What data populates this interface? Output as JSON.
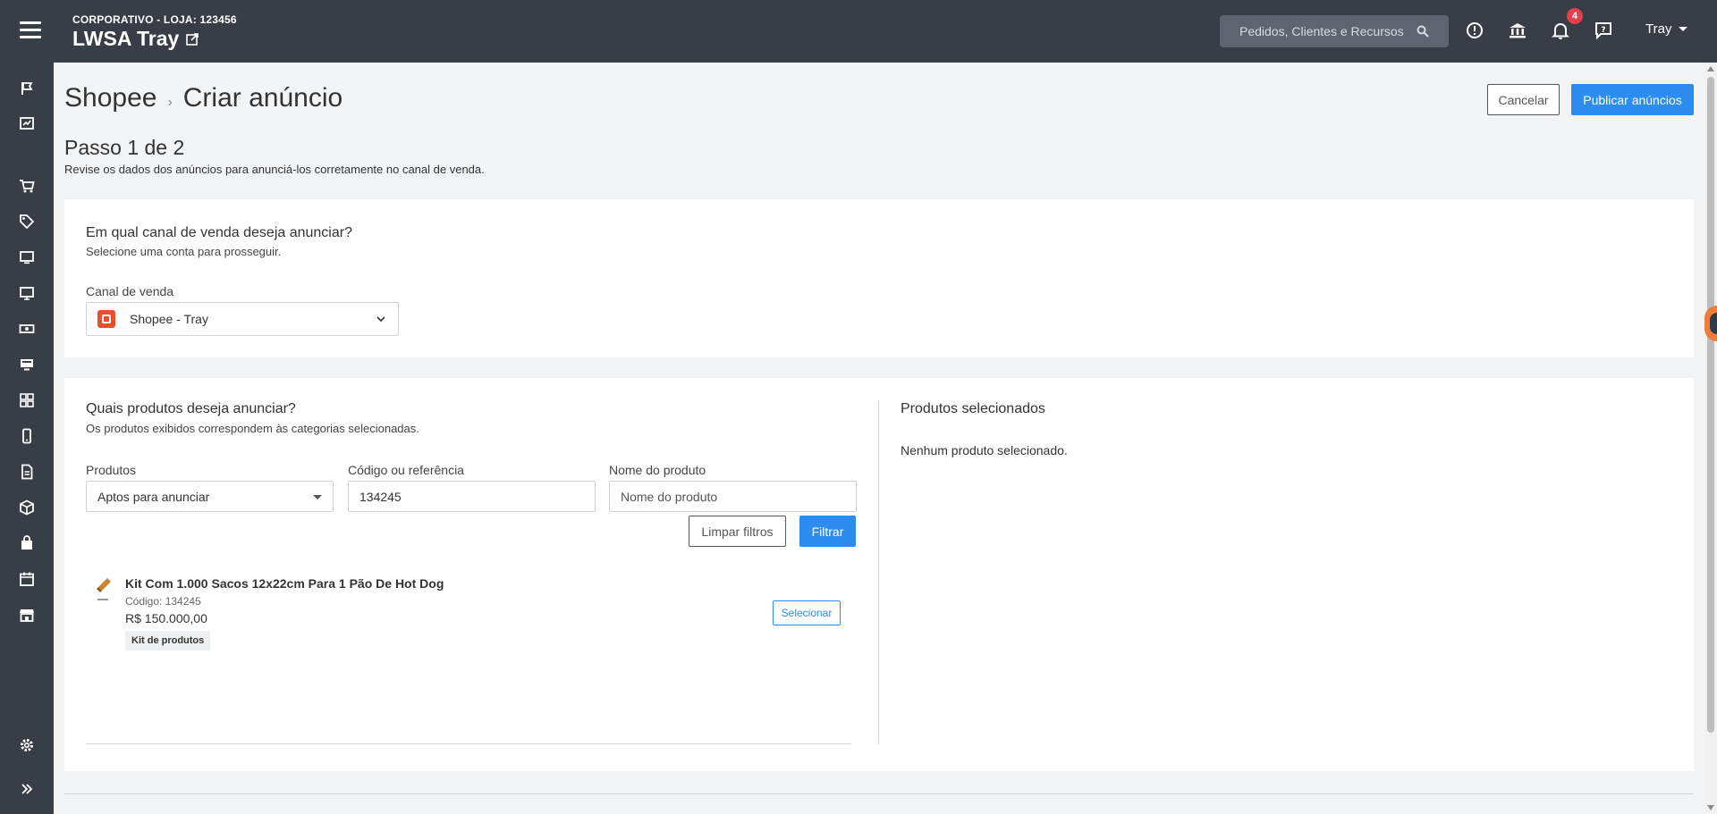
{
  "header": {
    "store_line": "CORPORATIVO - LOJA: 123456",
    "store_name": "LWSA Tray",
    "search_placeholder": "Pedidos, Clientes e Recursos",
    "notifications_count": "4",
    "user_name": "Tray"
  },
  "sidebar": {
    "icons": [
      "flag-icon",
      "dashboard-icon",
      "cart-icon",
      "tag-icon",
      "monitor-icon",
      "screen-icon",
      "money-icon",
      "desktop-icon",
      "apps-icon",
      "mobile-icon",
      "document-icon",
      "box-icon",
      "bag-icon",
      "calendar-icon",
      "store-icon",
      "settings-icon",
      "expand-icon"
    ]
  },
  "page": {
    "breadcrumb_root": "Shopee",
    "breadcrumb_separator": "›",
    "breadcrumb_current": "Criar anúncio",
    "cancel_label": "Cancelar",
    "publish_label": "Publicar anúncios",
    "step_title": "Passo 1 de 2",
    "step_subtitle": "Revise os dados dos anúncios para anunciá-los corretamente no canal de venda."
  },
  "channel_card": {
    "title": "Em qual canal de venda deseja anunciar?",
    "subtitle": "Selecione uma conta para prosseguir.",
    "field_label": "Canal de venda",
    "selected_channel": "Shopee - Tray"
  },
  "products_card": {
    "title": "Quais produtos deseja anunciar?",
    "subtitle": "Os produtos exibidos correspondem às categorias selecionadas.",
    "filters": {
      "products_label": "Produtos",
      "products_value": "Aptos para anunciar",
      "code_label": "Código ou referência",
      "code_value": "134245",
      "name_label": "Nome do produto",
      "name_placeholder": "Nome do produto"
    },
    "clear_label": "Limpar filtros",
    "filter_label": "Filtrar",
    "items": [
      {
        "name": "Kit Com 1.000 Sacos 12x22cm Para 1 Pão De Hot Dog",
        "code": "Código: 134245",
        "price": "R$ 150.000,00",
        "tag": "Kit de produtos",
        "select_label": "Selecionar"
      }
    ]
  },
  "selected_panel": {
    "title": "Produtos selecionados",
    "empty_text": "Nenhum produto selecionado."
  },
  "colors": {
    "primary": "#2d8cf0",
    "topbar": "#383e48",
    "badge": "#e53e4d",
    "shopee": "#ee4d2d"
  }
}
